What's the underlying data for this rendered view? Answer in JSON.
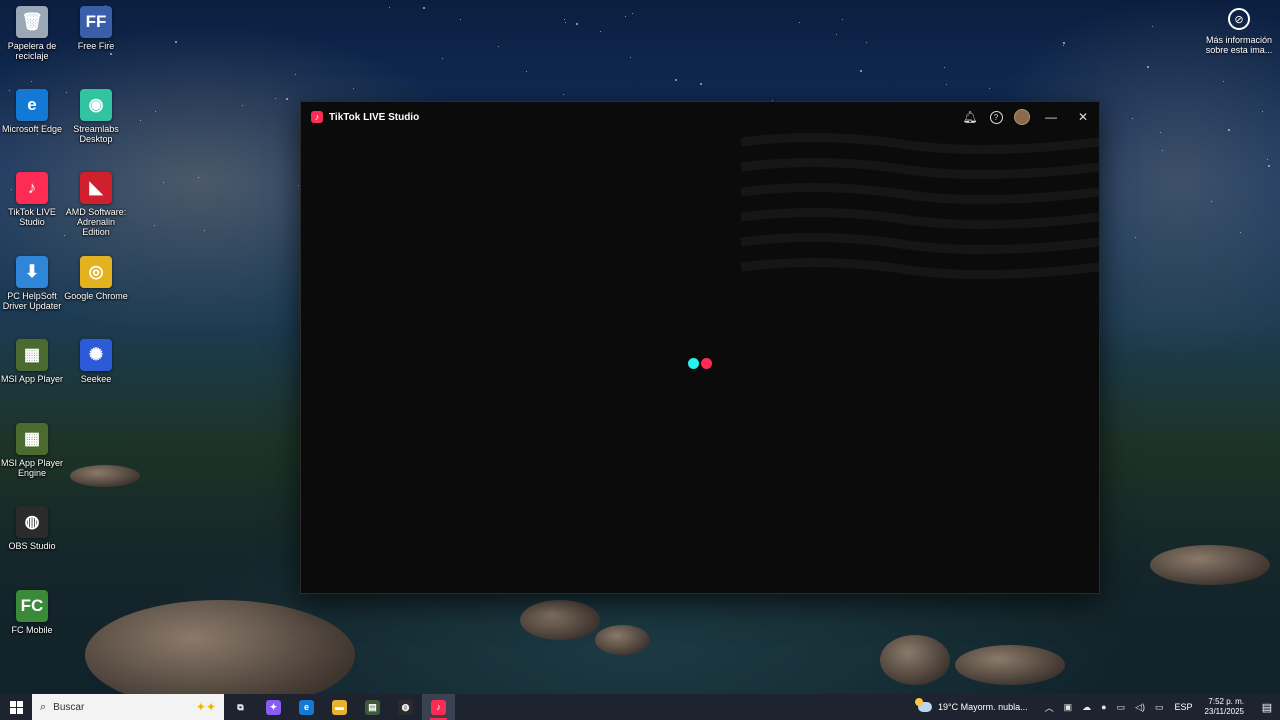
{
  "desktop": {
    "icons": [
      {
        "label": "Papelera de reciclaje",
        "glyph": "🗑",
        "color": "#9aa8b6",
        "icon": "recycle-bin-icon"
      },
      {
        "label": "Free Fire",
        "glyph": "FF",
        "color": "#3b5ea8",
        "icon": "free-fire-icon"
      },
      {
        "label": "Microsoft Edge",
        "glyph": "e",
        "color": "#1479d4",
        "icon": "edge-icon"
      },
      {
        "label": "Streamlabs Desktop",
        "glyph": "◉",
        "color": "#31c3a2",
        "icon": "streamlabs-icon"
      },
      {
        "label": "TikTok LIVE Studio",
        "glyph": "♪",
        "color": "#fe2c55",
        "icon": "tiktok-live-icon"
      },
      {
        "label": "AMD Software: Adrenalin Edition",
        "glyph": "◣",
        "color": "#d01f2d",
        "icon": "amd-icon"
      },
      {
        "label": "PC HelpSoft Driver Updater",
        "glyph": "⬇",
        "color": "#2f86d8",
        "icon": "pc-helpsoft-icon"
      },
      {
        "label": "Google Chrome",
        "glyph": "◎",
        "color": "#e3b21f",
        "icon": "chrome-icon"
      },
      {
        "label": "MSI App Player",
        "glyph": "▦",
        "color": "#4a6a2f",
        "icon": "msi-app-player-icon"
      },
      {
        "label": "Seekee",
        "glyph": "✺",
        "color": "#2d5bd8",
        "icon": "seekee-icon"
      },
      {
        "label": "MSI App Player Engine",
        "glyph": "▦",
        "color": "#4a6a2f",
        "icon": "msi-engine-icon"
      },
      {
        "label": "OBS Studio",
        "glyph": "◍",
        "color": "#2b2b2b",
        "icon": "obs-icon"
      },
      {
        "label": "FC Mobile",
        "glyph": "FC",
        "color": "#3a8a3a",
        "icon": "fc-mobile-icon"
      }
    ],
    "info_label": "Más información sobre esta ima..."
  },
  "window": {
    "title": "TikTok LIVE Studio",
    "logo_glyph": "♪",
    "loader_colors": [
      "#25f4ee",
      "#fe2c55"
    ]
  },
  "taskbar": {
    "search_placeholder": "Buscar",
    "apps": [
      {
        "icon": "task-view-icon",
        "glyph": "⧉",
        "color": "transparent"
      },
      {
        "icon": "copilot-icon",
        "glyph": "✦",
        "color": "#8a5cf6"
      },
      {
        "icon": "edge-icon",
        "glyph": "e",
        "color": "#1479d4"
      },
      {
        "icon": "file-explorer-icon",
        "glyph": "▬",
        "color": "#e7b232"
      },
      {
        "icon": "terminal-icon",
        "glyph": "▤",
        "color": "#3a5a3a"
      },
      {
        "icon": "obs-icon",
        "glyph": "◍",
        "color": "#2b2b2b"
      },
      {
        "icon": "tiktok-live-icon",
        "glyph": "♪",
        "color": "#fe2c55"
      }
    ],
    "weather": "19°C  Mayorm. nubla...",
    "language": "ESP",
    "time": "7:52 p. m.",
    "date": "23/11/2025"
  }
}
